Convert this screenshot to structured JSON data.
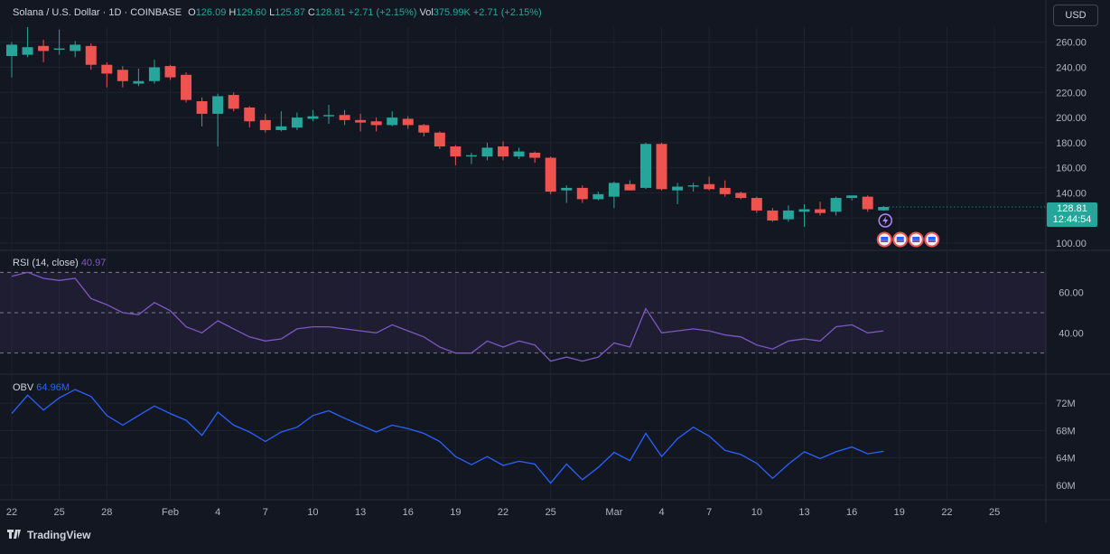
{
  "header": {
    "symbol": "Solana / U.S. Dollar · 1D · COINBASE",
    "o_label": "O",
    "o": "126.09",
    "h_label": "H",
    "h": "129.60",
    "l_label": "L",
    "l": "125.87",
    "c_label": "C",
    "c": "128.81",
    "change": "+2.71 (+2.15%)",
    "vol_label": "Vol",
    "vol": "375.99K",
    "vol_change": "+2.71 (+2.15%)"
  },
  "currency": "USD",
  "last_price": {
    "value": "128.81",
    "countdown": "12:44:54"
  },
  "rsi_label": {
    "name": "RSI (14, close)",
    "value": "40.97"
  },
  "obv_label": {
    "name": "OBV",
    "value": "64.96M"
  },
  "branding": "TradingView",
  "colors": {
    "up": "#26a69a",
    "down": "#ef5350",
    "rsi": "#7e57c2",
    "obv": "#2962ff",
    "background": "#131722"
  },
  "chart_data": {
    "type": "candlestick",
    "price_axis": {
      "ylim": [
        95,
        272
      ],
      "ticks": [
        100,
        120,
        140,
        160,
        180,
        200,
        220,
        240,
        260
      ],
      "tick_labels": [
        "100.00",
        "120.00",
        "140.00",
        "160.00",
        "180.00",
        "200.00",
        "220.00",
        "240.00",
        "260.00"
      ]
    },
    "x_ticks": [
      {
        "i": 0,
        "label": "22"
      },
      {
        "i": 3,
        "label": "25"
      },
      {
        "i": 6,
        "label": "28"
      },
      {
        "i": 10,
        "label": "Feb"
      },
      {
        "i": 13,
        "label": "4"
      },
      {
        "i": 16,
        "label": "7"
      },
      {
        "i": 19,
        "label": "10"
      },
      {
        "i": 22,
        "label": "13"
      },
      {
        "i": 25,
        "label": "16"
      },
      {
        "i": 28,
        "label": "19"
      },
      {
        "i": 31,
        "label": "22"
      },
      {
        "i": 34,
        "label": "25"
      },
      {
        "i": 38,
        "label": "Mar"
      },
      {
        "i": 41,
        "label": "4"
      },
      {
        "i": 44,
        "label": "7"
      },
      {
        "i": 47,
        "label": "10"
      },
      {
        "i": 50,
        "label": "13"
      },
      {
        "i": 53,
        "label": "16"
      },
      {
        "i": 56,
        "label": "19"
      },
      {
        "i": 59,
        "label": "22"
      },
      {
        "i": 62,
        "label": "25"
      }
    ],
    "candles": [
      {
        "o": 249,
        "h": 260,
        "l": 232,
        "c": 258
      },
      {
        "o": 250,
        "h": 272,
        "l": 248,
        "c": 256
      },
      {
        "o": 257,
        "h": 262,
        "l": 244,
        "c": 253
      },
      {
        "o": 254,
        "h": 270,
        "l": 250,
        "c": 255
      },
      {
        "o": 253,
        "h": 261,
        "l": 248,
        "c": 258
      },
      {
        "o": 257,
        "h": 259,
        "l": 238,
        "c": 242
      },
      {
        "o": 242,
        "h": 244,
        "l": 224,
        "c": 235
      },
      {
        "o": 238,
        "h": 241,
        "l": 224,
        "c": 229
      },
      {
        "o": 227,
        "h": 239,
        "l": 225,
        "c": 229
      },
      {
        "o": 229,
        "h": 246,
        "l": 227,
        "c": 240
      },
      {
        "o": 241,
        "h": 242,
        "l": 230,
        "c": 232
      },
      {
        "o": 234,
        "h": 236,
        "l": 212,
        "c": 214
      },
      {
        "o": 213,
        "h": 216,
        "l": 193,
        "c": 203
      },
      {
        "o": 203,
        "h": 219,
        "l": 177,
        "c": 217
      },
      {
        "o": 218,
        "h": 220,
        "l": 205,
        "c": 207
      },
      {
        "o": 208,
        "h": 209,
        "l": 192,
        "c": 197
      },
      {
        "o": 198,
        "h": 203,
        "l": 188,
        "c": 190
      },
      {
        "o": 190,
        "h": 205,
        "l": 189,
        "c": 193
      },
      {
        "o": 192,
        "h": 204,
        "l": 190,
        "c": 200
      },
      {
        "o": 199,
        "h": 206,
        "l": 197,
        "c": 201
      },
      {
        "o": 201,
        "h": 210,
        "l": 195,
        "c": 202
      },
      {
        "o": 202,
        "h": 206,
        "l": 194,
        "c": 198
      },
      {
        "o": 198,
        "h": 203,
        "l": 189,
        "c": 196
      },
      {
        "o": 197,
        "h": 200,
        "l": 189,
        "c": 194
      },
      {
        "o": 194,
        "h": 205,
        "l": 193,
        "c": 200
      },
      {
        "o": 199,
        "h": 201,
        "l": 191,
        "c": 194
      },
      {
        "o": 194,
        "h": 195,
        "l": 185,
        "c": 188
      },
      {
        "o": 188,
        "h": 189,
        "l": 175,
        "c": 177
      },
      {
        "o": 177,
        "h": 178,
        "l": 162,
        "c": 169
      },
      {
        "o": 169,
        "h": 172,
        "l": 163,
        "c": 170
      },
      {
        "o": 169,
        "h": 180,
        "l": 166,
        "c": 176
      },
      {
        "o": 177,
        "h": 181,
        "l": 166,
        "c": 169
      },
      {
        "o": 169,
        "h": 176,
        "l": 167,
        "c": 173
      },
      {
        "o": 172,
        "h": 173,
        "l": 164,
        "c": 168
      },
      {
        "o": 168,
        "h": 169,
        "l": 139,
        "c": 141
      },
      {
        "o": 142,
        "h": 146,
        "l": 132,
        "c": 144
      },
      {
        "o": 144,
        "h": 146,
        "l": 132,
        "c": 135
      },
      {
        "o": 135,
        "h": 141,
        "l": 134,
        "c": 139
      },
      {
        "o": 137,
        "h": 149,
        "l": 128,
        "c": 148
      },
      {
        "o": 147,
        "h": 150,
        "l": 142,
        "c": 142
      },
      {
        "o": 144,
        "h": 180,
        "l": 143,
        "c": 179
      },
      {
        "o": 179,
        "h": 180,
        "l": 142,
        "c": 143
      },
      {
        "o": 142,
        "h": 148,
        "l": 131,
        "c": 145
      },
      {
        "o": 145,
        "h": 148,
        "l": 141,
        "c": 146
      },
      {
        "o": 147,
        "h": 153,
        "l": 142,
        "c": 143
      },
      {
        "o": 144,
        "h": 150,
        "l": 137,
        "c": 139
      },
      {
        "o": 140,
        "h": 141,
        "l": 135,
        "c": 136
      },
      {
        "o": 136,
        "h": 137,
        "l": 124,
        "c": 126
      },
      {
        "o": 126,
        "h": 128,
        "l": 117,
        "c": 118
      },
      {
        "o": 119,
        "h": 130,
        "l": 117,
        "c": 126
      },
      {
        "o": 125,
        "h": 131,
        "l": 113,
        "c": 127
      },
      {
        "o": 127,
        "h": 133,
        "l": 122,
        "c": 124
      },
      {
        "o": 125,
        "h": 137,
        "l": 122,
        "c": 136
      },
      {
        "o": 136,
        "h": 138,
        "l": 134,
        "c": 138
      },
      {
        "o": 137,
        "h": 138,
        "l": 125,
        "c": 127
      },
      {
        "o": 126.09,
        "h": 129.6,
        "l": 125.87,
        "c": 128.81
      }
    ],
    "rsi": {
      "name": "RSI (14, close)",
      "ylim": [
        20,
        80
      ],
      "bands": [
        30,
        50,
        70
      ],
      "ticks": [
        40,
        60
      ],
      "tick_labels": [
        "40.00",
        "60.00"
      ],
      "values": [
        68,
        70,
        67,
        66,
        67,
        57,
        54,
        50,
        49,
        55,
        51,
        43,
        40,
        46,
        42,
        38,
        36,
        37,
        42,
        43,
        43,
        42,
        41,
        40,
        44,
        41,
        38,
        33,
        30,
        30,
        36,
        33,
        36,
        34,
        26,
        28,
        26,
        28,
        35,
        33,
        52,
        40,
        41,
        42,
        41,
        39,
        38,
        34,
        32,
        36,
        37,
        36,
        43,
        44,
        40,
        41
      ]
    },
    "obv": {
      "name": "OBV",
      "ylim": [
        58,
        76
      ],
      "ticks": [
        60,
        64,
        68,
        72
      ],
      "tick_labels": [
        "60M",
        "64M",
        "68M",
        "72M"
      ],
      "values": [
        70.5,
        73.2,
        71,
        72.8,
        74,
        73,
        70.2,
        68.8,
        70.2,
        71.6,
        70.5,
        69.5,
        67.3,
        70.7,
        68.8,
        67.8,
        66.4,
        67.8,
        68.5,
        70.2,
        70.9,
        69.8,
        68.8,
        67.8,
        68.8,
        68.3,
        67.6,
        66.4,
        64.2,
        63,
        64.2,
        62.9,
        63.5,
        63.1,
        60.3,
        63.1,
        60.8,
        62.6,
        64.8,
        63.6,
        67.6,
        64.2,
        66.8,
        68.5,
        67.2,
        65.1,
        64.5,
        63.2,
        61,
        63.1,
        64.9,
        63.9,
        64.9,
        65.6,
        64.6,
        64.96
      ]
    },
    "annotations": {
      "event_markers": 4,
      "dividend_marker": 1
    }
  }
}
